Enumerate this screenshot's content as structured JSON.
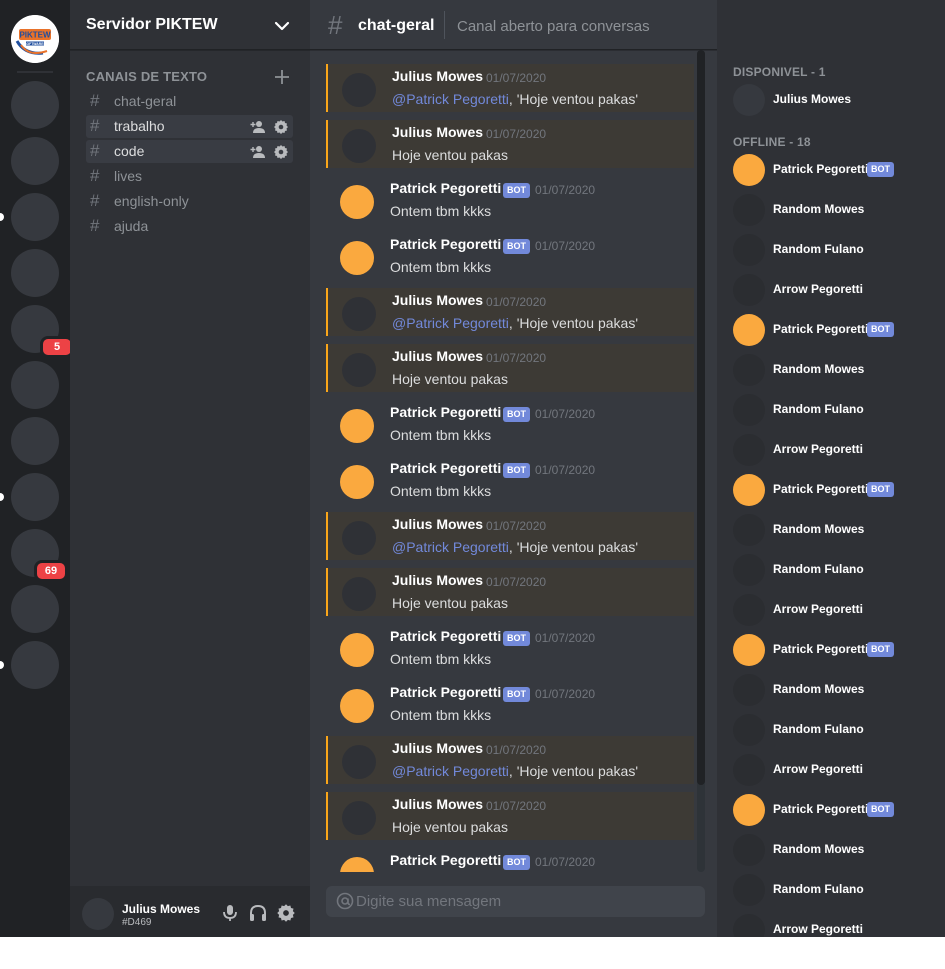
{
  "servers": {
    "logo_text": "PIKTEW",
    "logo_subtext": "SOFTWARES",
    "badges": [
      "5",
      "69"
    ]
  },
  "sidebar": {
    "server_name": "Servidor PIKTEW",
    "category_label": "CANAIS DE TEXTO",
    "channels": [
      {
        "name": "chat-geral"
      },
      {
        "name": "trabalho"
      },
      {
        "name": "code"
      },
      {
        "name": "lives"
      },
      {
        "name": "english-only"
      },
      {
        "name": "ajuda"
      }
    ]
  },
  "user": {
    "name": "Julius Mowes",
    "tag": "#D469"
  },
  "chat": {
    "channel_hash": "#",
    "channel_name": "chat-geral",
    "topic": "Canal aberto para conversas",
    "input_placeholder": "Digite sua mensagem"
  },
  "messages": [
    {
      "author": "Julius Mowes",
      "bot": false,
      "time": "01/07/2020",
      "mention": "@Patrick Pegoretti",
      "text": ", 'Hoje ventou pakas'"
    },
    {
      "author": "Julius Mowes",
      "bot": false,
      "time": "01/07/2020",
      "mention": "",
      "text": "Hoje ventou pakas"
    },
    {
      "author": "Patrick Pegoretti",
      "bot": true,
      "time": "01/07/2020",
      "mention": "",
      "text": "Ontem tbm kkks"
    },
    {
      "author": "Patrick Pegoretti",
      "bot": true,
      "time": "01/07/2020",
      "mention": "",
      "text": "Ontem tbm kkks"
    },
    {
      "author": "Julius Mowes",
      "bot": false,
      "time": "01/07/2020",
      "mention": "@Patrick Pegoretti",
      "text": ", 'Hoje ventou pakas'"
    },
    {
      "author": "Julius Mowes",
      "bot": false,
      "time": "01/07/2020",
      "mention": "",
      "text": "Hoje ventou pakas"
    },
    {
      "author": "Patrick Pegoretti",
      "bot": true,
      "time": "01/07/2020",
      "mention": "",
      "text": "Ontem tbm kkks"
    },
    {
      "author": "Patrick Pegoretti",
      "bot": true,
      "time": "01/07/2020",
      "mention": "",
      "text": "Ontem tbm kkks"
    },
    {
      "author": "Julius Mowes",
      "bot": false,
      "time": "01/07/2020",
      "mention": "@Patrick Pegoretti",
      "text": ", 'Hoje ventou pakas'"
    },
    {
      "author": "Julius Mowes",
      "bot": false,
      "time": "01/07/2020",
      "mention": "",
      "text": "Hoje ventou pakas"
    },
    {
      "author": "Patrick Pegoretti",
      "bot": true,
      "time": "01/07/2020",
      "mention": "",
      "text": "Ontem tbm kkks"
    },
    {
      "author": "Patrick Pegoretti",
      "bot": true,
      "time": "01/07/2020",
      "mention": "",
      "text": "Ontem tbm kkks"
    },
    {
      "author": "Julius Mowes",
      "bot": false,
      "time": "01/07/2020",
      "mention": "@Patrick Pegoretti",
      "text": ", 'Hoje ventou pakas'"
    },
    {
      "author": "Julius Mowes",
      "bot": false,
      "time": "01/07/2020",
      "mention": "",
      "text": "Hoje ventou pakas"
    },
    {
      "author": "Patrick Pegoretti",
      "bot": true,
      "time": "01/07/2020",
      "mention": "",
      "text": ""
    }
  ],
  "bot_label": "BOT",
  "members": {
    "online_header": "DISPONIVEL - 1",
    "offline_header": "OFFLINE - 18",
    "online": [
      {
        "name": "Julius Mowes",
        "bot": false
      }
    ],
    "offline": [
      {
        "name": "Patrick Pegoretti",
        "bot": true
      },
      {
        "name": "Random Mowes",
        "bot": false
      },
      {
        "name": "Random Fulano",
        "bot": false
      },
      {
        "name": "Arrow Pegoretti",
        "bot": false
      },
      {
        "name": "Patrick Pegoretti",
        "bot": true
      },
      {
        "name": "Random Mowes",
        "bot": false
      },
      {
        "name": "Random Fulano",
        "bot": false
      },
      {
        "name": "Arrow Pegoretti",
        "bot": false
      },
      {
        "name": "Patrick Pegoretti",
        "bot": true
      },
      {
        "name": "Random Mowes",
        "bot": false
      },
      {
        "name": "Random Fulano",
        "bot": false
      },
      {
        "name": "Arrow Pegoretti",
        "bot": false
      },
      {
        "name": "Patrick Pegoretti",
        "bot": true
      },
      {
        "name": "Random Mowes",
        "bot": false
      },
      {
        "name": "Random Fulano",
        "bot": false
      },
      {
        "name": "Arrow Pegoretti",
        "bot": false
      },
      {
        "name": "Patrick Pegoretti",
        "bot": true
      },
      {
        "name": "Random Mowes",
        "bot": false
      },
      {
        "name": "Random Fulano",
        "bot": false
      },
      {
        "name": "Arrow Pegoretti",
        "bot": false
      }
    ]
  },
  "colors": {
    "accent": "#7289da",
    "mention_border": "#faa61a",
    "bot_avatar": "#faa93f",
    "badge": "#ed4245"
  }
}
